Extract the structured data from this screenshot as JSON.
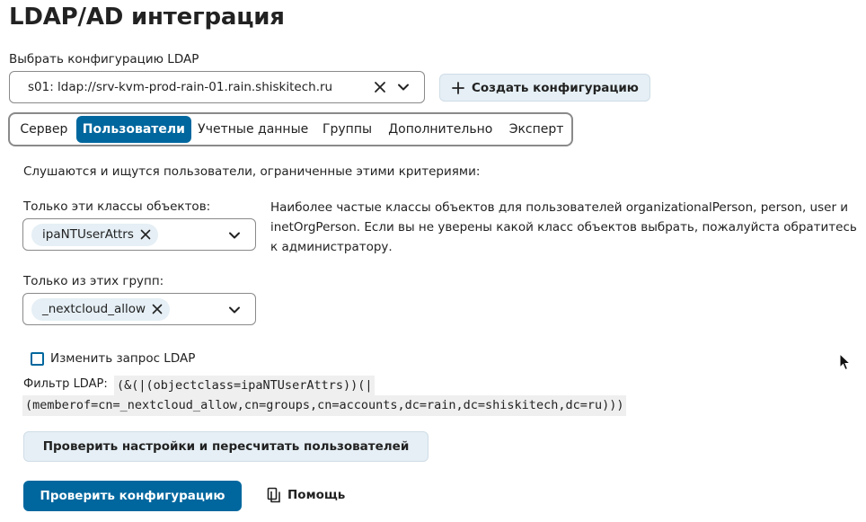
{
  "page": {
    "title": "LDAP/AD интеграция"
  },
  "config": {
    "label": "Выбрать конфигурацию LDAP",
    "selected": "s01: ldap://srv-kvm-prod-rain-01.rain.shiskitech.ru",
    "create_label": "Создать конфигурацию"
  },
  "tabs": [
    {
      "label": "Сервер",
      "active": false
    },
    {
      "label": "Пользователи",
      "active": true
    },
    {
      "label": "Учетные данные",
      "active": false
    },
    {
      "label": "Группы",
      "active": false
    },
    {
      "label": "Дополнительно",
      "active": false
    },
    {
      "label": "Эксперт",
      "active": false
    }
  ],
  "users": {
    "intro": "Слушаются и ищутся пользователи, ограниченные этими критериями:",
    "classes_label": "Только эти классы объектов:",
    "classes_chip": "ipaNTUserAttrs",
    "hint": "Наиболее частые классы объектов для пользователей organizationalPerson, person, user и inetOrgPerson. Если вы не уверены какой класс объектов выбрать, пожалуйста обратитесь к администратору.",
    "groups_label": "Только из этих групп:",
    "groups_chip": "_nextcloud_allow",
    "edit_query_label": "Изменить запрос LDAP",
    "filter_label": "Фильтр LDAP:",
    "filter_line1": "(&(|(objectclass=ipaNTUserAttrs))(|",
    "filter_line2": "(memberof=cn=_nextcloud_allow,cn=groups,cn=accounts,dc=rain,dc=shiskitech,dc=ru)))",
    "check_settings_label": "Проверить настройки и пересчитать пользователей"
  },
  "footer": {
    "verify_label": "Проверить конфигурацию",
    "help_label": "Помощь"
  },
  "colors": {
    "accent": "#00679e",
    "secondary_bg": "#e5eff5",
    "border": "#8a8a8a"
  }
}
